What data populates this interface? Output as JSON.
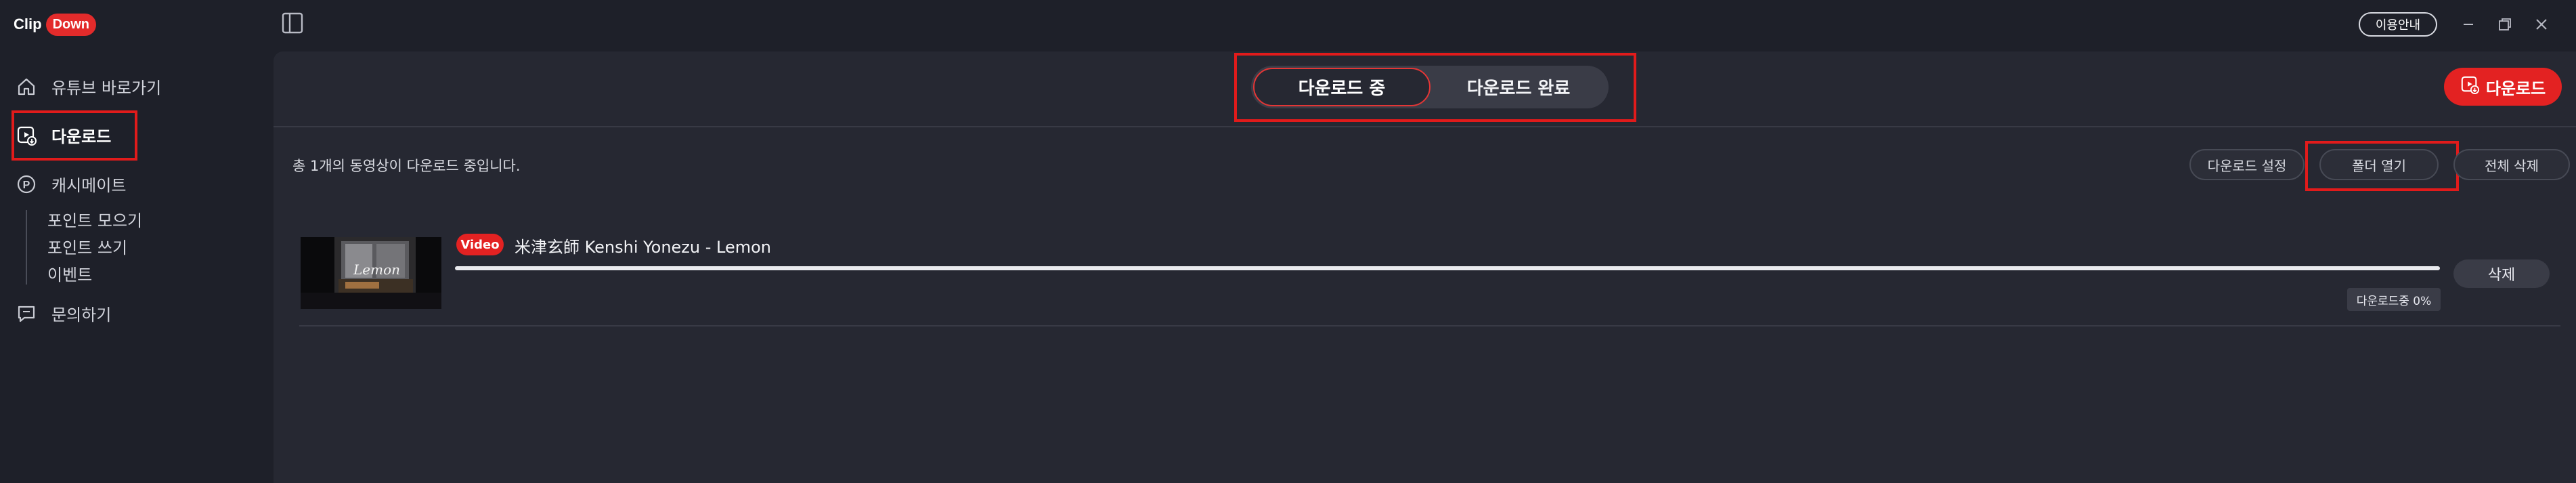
{
  "app": {
    "logo_clip": "Clip",
    "logo_down": "Down",
    "guide_button": "이용안내"
  },
  "sidebar": {
    "items": [
      {
        "label": "유튜브 바로가기",
        "icon": "home-icon"
      },
      {
        "label": "다운로드",
        "icon": "download-box-icon"
      },
      {
        "label": "캐시메이트",
        "icon": "point-p-icon"
      },
      {
        "label": "문의하기",
        "icon": "chat-icon"
      }
    ],
    "sub_items": [
      "포인트 모으기",
      "포인트 쓰기",
      "이벤트"
    ]
  },
  "tabs": {
    "downloading": "다운로드 중",
    "completed": "다운로드 완료"
  },
  "download_button": "다운로드",
  "summary_text": "총 1개의 동영상이 다운로드 중입니다.",
  "actions": {
    "settings": "다운로드 설정",
    "open_folder": "폴더 열기",
    "delete_all": "전체 삭제"
  },
  "downloads": [
    {
      "type_badge": "Video",
      "title": "米津玄師  Kenshi Yonezu  - Lemon",
      "thumbnail_text": "Lemon",
      "progress_percent": 0,
      "status": "다운로드중 0%",
      "delete_label": "삭제"
    }
  ],
  "colors": {
    "accent_red": "#e32222",
    "background": "#1e2029",
    "panel": "#262832",
    "highlight_box": "#e11b1b"
  }
}
